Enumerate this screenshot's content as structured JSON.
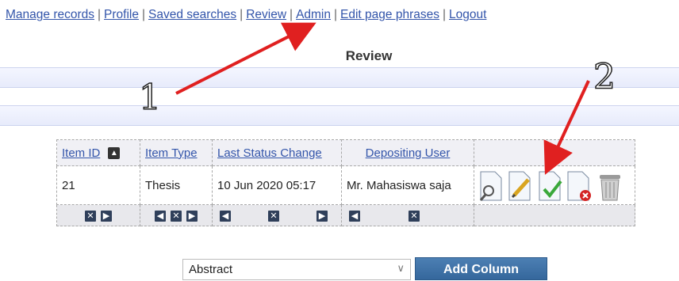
{
  "nav": {
    "items": [
      "Manage records",
      "Profile",
      "Saved searches",
      "Review",
      "Admin",
      "Edit page phrases",
      "Logout"
    ],
    "separator": "|"
  },
  "page": {
    "title": "Review"
  },
  "table": {
    "headers": {
      "item_id": "Item ID",
      "item_type": "Item Type",
      "last_status_change": "Last Status Change",
      "depositing_user": "Depositing User"
    },
    "rows": [
      {
        "item_id": "21",
        "item_type": "Thesis",
        "last_status_change": "10 Jun 2020 05:17",
        "depositing_user": "Mr. Mahasiswa saja"
      }
    ],
    "actions": [
      "view-icon",
      "edit-icon",
      "accept-icon",
      "reject-icon",
      "delete-icon"
    ]
  },
  "add_column": {
    "selected": "Abstract",
    "button_label": "Add Column"
  },
  "annotations": {
    "label_1": "1",
    "label_2": "2",
    "arrow_color": "#e02020"
  },
  "colors": {
    "link": "#3355aa",
    "band": "#e9edfb",
    "button": "#3f73a8"
  }
}
